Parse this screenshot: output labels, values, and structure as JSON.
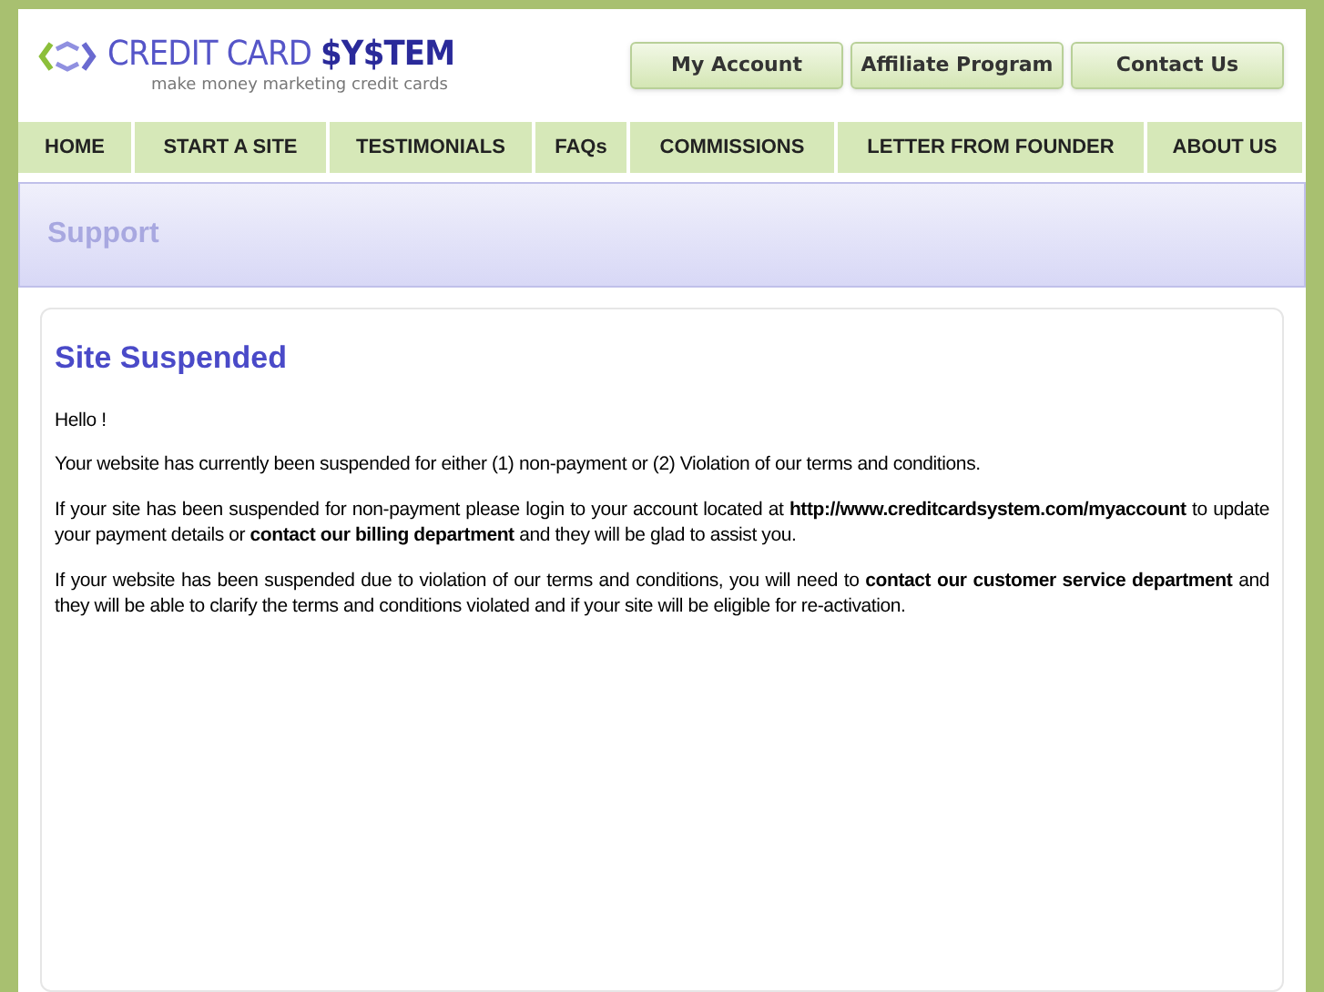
{
  "logo": {
    "name": "CREDIT CARD ",
    "highlight": "$Y$TEM",
    "tagline": "make money marketing credit cards"
  },
  "header_buttons": [
    "My Account",
    "Affiliate Program",
    "Contact Us"
  ],
  "nav": [
    "HOME",
    "START A SITE",
    "TESTIMONIALS",
    "FAQs",
    "COMMISSIONS",
    "LETTER FROM FOUNDER",
    "ABOUT US"
  ],
  "banner": {
    "title": "Support"
  },
  "content": {
    "heading": "Site Suspended",
    "paragraphs": [
      "Hello !",
      "Your website has currently been suspended for either (1) non-payment or (2) Violation of our terms and conditions.",
      "If your site has been suspended for non-payment please login to your account located at **http://www.creditcardsystem.com/myaccount** to update your payment details or **contact our billing department** and they will be glad to assist you.",
      "If your website has been suspended due to violation of our terms and conditions, you will need to **contact our customer service department** and they will be able to clarify the terms and conditions violated and if your site will be eligible for re-activation."
    ]
  }
}
